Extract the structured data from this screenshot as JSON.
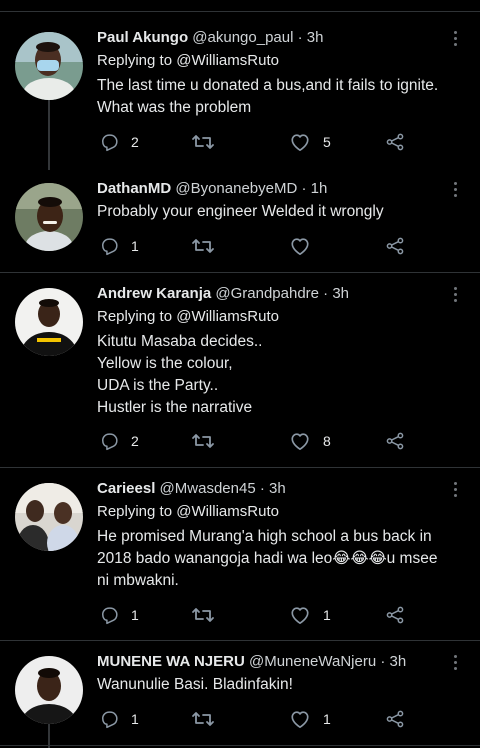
{
  "tweets": [
    {
      "name": "Paul Akungo",
      "handle": "@akungo_paul",
      "dot": "·",
      "time": "3h",
      "reply_to": "Replying to @WilliamsRuto",
      "text": "The last time u donated a bus,and it fails to ignite.\nWhat was the problem",
      "replies": "2",
      "retweets": "",
      "likes": "5"
    },
    {
      "name": "DathanMD",
      "handle": "@ByonanebyeMD",
      "dot": "·",
      "time": "1h",
      "reply_to": "",
      "text": "Probably your engineer Welded it wrongly",
      "replies": "1",
      "retweets": "",
      "likes": ""
    },
    {
      "name": "Andrew Karanja",
      "handle": "@Grandpahdre",
      "dot": "·",
      "time": "3h",
      "reply_to": "Replying to @WilliamsRuto",
      "text": "Kitutu Masaba decides..\nYellow is the colour,\nUDA is the Party..\nHustler is the narrative",
      "replies": "2",
      "retweets": "",
      "likes": "8"
    },
    {
      "name": "Carieesl",
      "handle": "@Mwasden45",
      "dot": "·",
      "time": "3h",
      "reply_to": "Replying to @WilliamsRuto",
      "text": "He promised Murang'a high school a bus back in\n2018 bado wanangoja hadi wa leo😂😂😂u msee\nni mbwakni.",
      "replies": "1",
      "retweets": "",
      "likes": "1"
    },
    {
      "name": "MUNENE WA NJERU",
      "handle": "@MuneneWaNjeru",
      "dot": "·",
      "time": "3h",
      "reply_to": "",
      "text": "Wanunulie Basi. Bladinfakin!",
      "replies": "1",
      "retweets": "",
      "likes": "1"
    }
  ],
  "icons": {
    "reply": "reply-icon",
    "retweet": "retweet-icon",
    "like": "heart-icon",
    "share": "share-icon",
    "more": "more-icon"
  },
  "colors": {
    "background": "#000000",
    "text": "#e7e9ea",
    "icon": "#8b98a5",
    "divider": "#2f3336"
  }
}
